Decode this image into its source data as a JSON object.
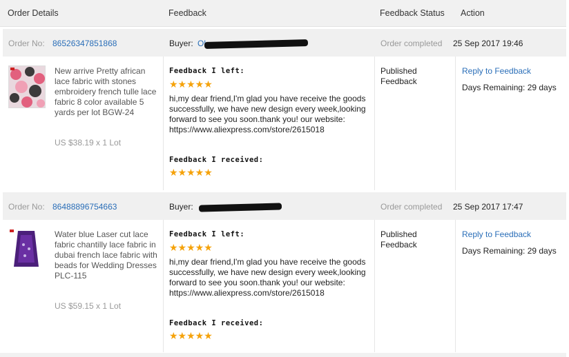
{
  "header": {
    "order_details": "Order Details",
    "feedback": "Feedback",
    "feedback_status": "Feedback Status",
    "action": "Action"
  },
  "orders": [
    {
      "order_no_label": "Order No:",
      "order_no": "86526347851868",
      "buyer_label": "Buyer:",
      "completed_label": "Order completed",
      "completed_date": "25 Sep 2017 19:46",
      "product_name": "New arrive Pretty african lace fabric with stones embroidery french tulle lace fabric 8 color available 5 yards per lot BGW-24",
      "price": "US $38.19 x 1 Lot",
      "feedback_left_label": "Feedback I left:",
      "stars_left": "★★★★★",
      "feedback_text": "hi,my dear friend,I'm glad you have receive the goods successfully, we have new design every week,looking forward to see you soon.thank you! our website: https://www.aliexpress.com/store/2615018",
      "feedback_received_label": "Feedback I received:",
      "stars_received": "★★★★★",
      "status": "Published Feedback",
      "reply_link": "Reply to Feedback",
      "days_remaining": "Days Remaining: 29 days"
    },
    {
      "order_no_label": "Order No:",
      "order_no": "86488896754663",
      "buyer_label": "Buyer:",
      "completed_label": "Order completed",
      "completed_date": "25 Sep 2017 17:47",
      "product_name": "Water blue Laser cut lace fabric chantilly lace fabric in dubai french lace fabric with beads for Wedding Dresses PLC-115",
      "price": "US $59.15 x 1 Lot",
      "feedback_left_label": "Feedback I left:",
      "stars_left": "★★★★★",
      "feedback_text": "hi,my dear friend,I'm glad you have receive the goods successfully, we have new design every week,looking forward to see you soon.thank you! our website: https://www.aliexpress.com/store/2615018",
      "feedback_received_label": "Feedback I received:",
      "stars_received": "★★★★★",
      "status": "Published Feedback",
      "reply_link": "Reply to Feedback",
      "days_remaining": "Days Remaining: 29 days"
    }
  ],
  "colors": {
    "link": "#2a6eb8",
    "star": "#f5a20a",
    "header_bg": "#f1f1f1"
  }
}
